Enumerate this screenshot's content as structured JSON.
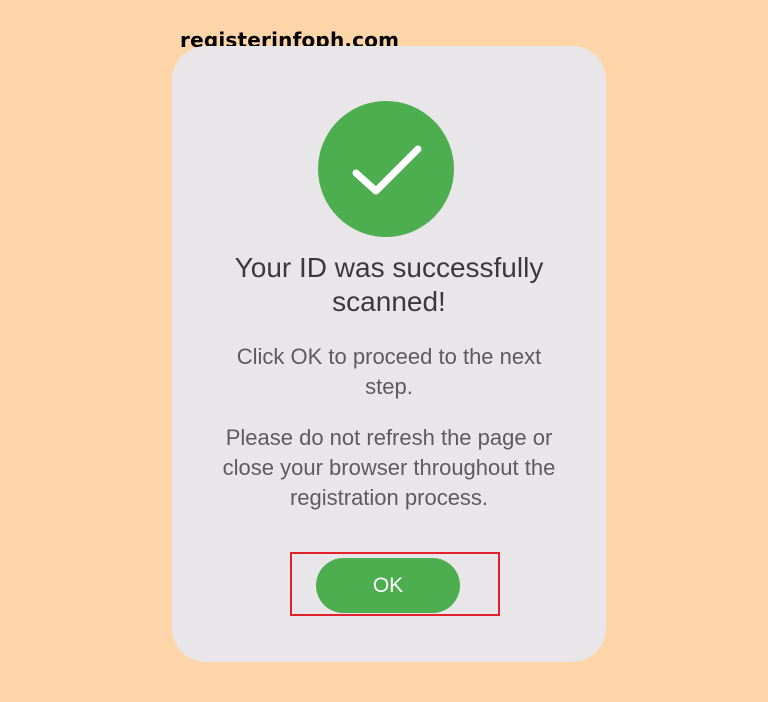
{
  "watermark": "registerinfoph.com",
  "dialog": {
    "icon": "checkmark-icon",
    "title": "Your ID was successfully\nscanned!",
    "message1": "Click OK to proceed to the next\nstep.",
    "message2": "Please do not refresh the page or\nclose your browser throughout the\nregistration process.",
    "ok_label": "OK"
  },
  "colors": {
    "background": "#fdd5a9",
    "card": "#e9e6e9",
    "accent_green": "#4cae4f",
    "highlight_red": "#e3222e"
  }
}
